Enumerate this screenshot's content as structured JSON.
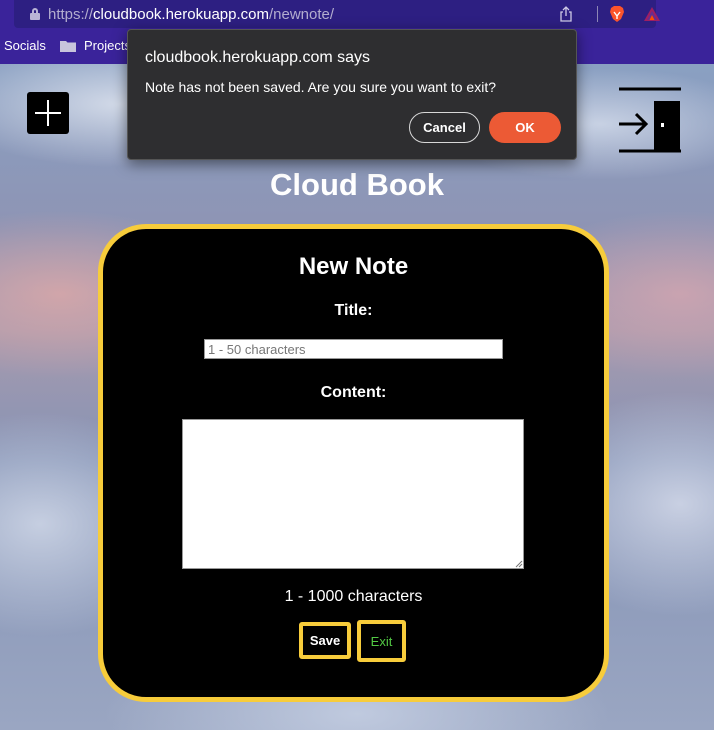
{
  "browser": {
    "url_prefix": "https://",
    "url_host": "cloudbook.herokuapp.com",
    "url_path": "/newnote/",
    "bookmarks": [
      {
        "label": "Socials"
      },
      {
        "label": "Projects"
      }
    ],
    "icons": [
      "lock-icon",
      "share-icon",
      "brave-shield-icon",
      "bat-rewards-icon",
      "folder-icon"
    ]
  },
  "dialog": {
    "title": "cloudbook.herokuapp.com says",
    "message": "Note has not been saved. Are you sure you want to exit?",
    "cancel_label": "Cancel",
    "ok_label": "OK"
  },
  "page": {
    "icons": [
      "plus-icon",
      "exit-door-icon"
    ],
    "app_title": "Cloud Book",
    "card": {
      "heading": "New Note",
      "title_label": "Title:",
      "title_placeholder": "1 - 50 characters",
      "title_value": "",
      "content_label": "Content:",
      "content_value": "",
      "content_hint": "1 - 1000 characters",
      "save_label": "Save",
      "exit_label": "Exit"
    }
  },
  "colors": {
    "chrome_bg": "#3a239a",
    "accent_border": "#f7cc3b",
    "ok_button": "#ec5a35",
    "exit_text": "#52c844"
  }
}
